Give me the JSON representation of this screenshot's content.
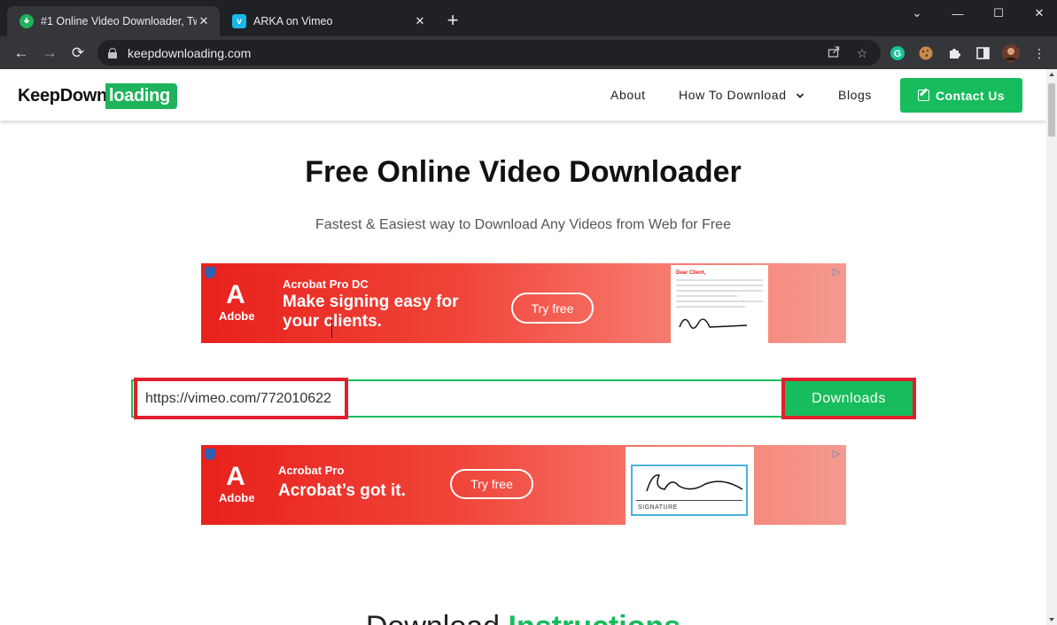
{
  "browser": {
    "tabs": [
      {
        "title": "#1 Online Video Downloader, Tw",
        "active": true,
        "favicon": "keepdownloading-favicon"
      },
      {
        "title": "ARKA on Vimeo",
        "active": false,
        "favicon": "vimeo-favicon",
        "favicon_glyph": "v"
      }
    ],
    "tab_close_glyph": "✕",
    "new_tab_glyph": "+",
    "window_controls": {
      "minimize": "⌄",
      "restore": "—",
      "maximize": "☐",
      "close": "✕"
    },
    "url": "keepdownloading.com",
    "nav_glyphs": {
      "back": "←",
      "forward": "→",
      "reload": "⟳"
    },
    "menu_glyph": "⋮"
  },
  "site": {
    "logo_part1": "KeepDown",
    "logo_part2": "loading",
    "nav": {
      "about": "About",
      "how_to": "How To Download",
      "blogs": "Blogs",
      "contact": "Contact Us"
    },
    "hero_title": "Free Online Video Downloader",
    "hero_subtitle": "Fastest & Easiest way to Download Any Videos from Web for Free",
    "ad1": {
      "brand": "Adobe",
      "product": "Acrobat Pro DC",
      "headline_line1": "Make signing easy for",
      "headline_line2": "your clients.",
      "cta": "Try free",
      "doc_title": "Dear Client,"
    },
    "ad2": {
      "brand": "Adobe",
      "product": "Acrobat Pro",
      "headline": "Acrobat’s got it.",
      "cta": "Try free",
      "signature_label": "SIGNATURE"
    },
    "url_input_value": "https://vimeo.com/772010622",
    "download_button": "Downloads",
    "instructions_part1": "Download ",
    "instructions_part2": "Instructions"
  },
  "colors": {
    "brand_green": "#17bc5c",
    "highlight_red": "#e0202e",
    "adobe_red": "#e8211c"
  }
}
